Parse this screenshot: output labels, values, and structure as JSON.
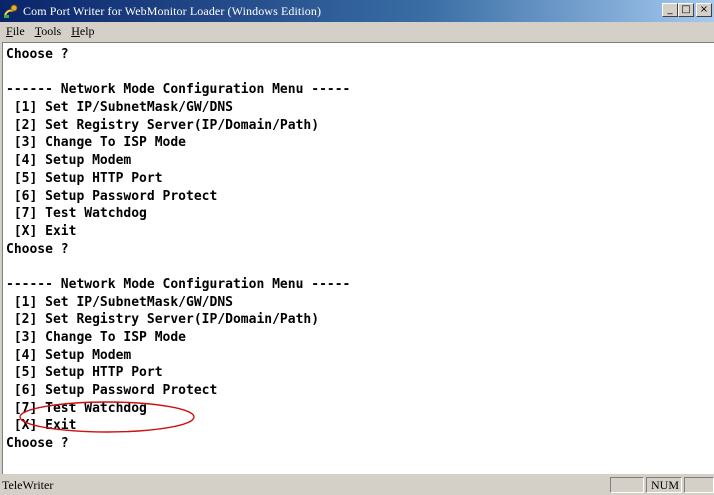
{
  "window": {
    "title": "Com Port Writer for WebMonitor Loader (Windows Edition)",
    "buttons": {
      "minimize": "_",
      "maximize": "□",
      "close": "×"
    }
  },
  "menu": [
    {
      "label": "File",
      "mnemonic": "F"
    },
    {
      "label": "Tools",
      "mnemonic": "T"
    },
    {
      "label": "Help",
      "mnemonic": "H"
    }
  ],
  "terminal": {
    "lines": [
      "Choose ?",
      "",
      "------ Network Mode Configuration Menu -----",
      " [1] Set IP/SubnetMask/GW/DNS",
      " [2] Set Registry Server(IP/Domain/Path)",
      " [3] Change To ISP Mode",
      " [4] Setup Modem",
      " [5] Setup HTTP Port",
      " [6] Setup Password Protect",
      " [7] Test Watchdog",
      " [X] Exit",
      "Choose ?",
      "",
      "------ Network Mode Configuration Menu -----",
      " [1] Set IP/SubnetMask/GW/DNS",
      " [2] Set Registry Server(IP/Domain/Path)",
      " [3] Change To ISP Mode",
      " [4] Setup Modem",
      " [5] Setup HTTP Port",
      " [6] Setup Password Protect",
      " [7] Test Watchdog",
      " [X] Exit",
      "Choose ?"
    ],
    "annotation_color": "#d01010"
  },
  "status": {
    "text": "TeleWriter",
    "panels": [
      "",
      "NUM",
      ""
    ]
  }
}
